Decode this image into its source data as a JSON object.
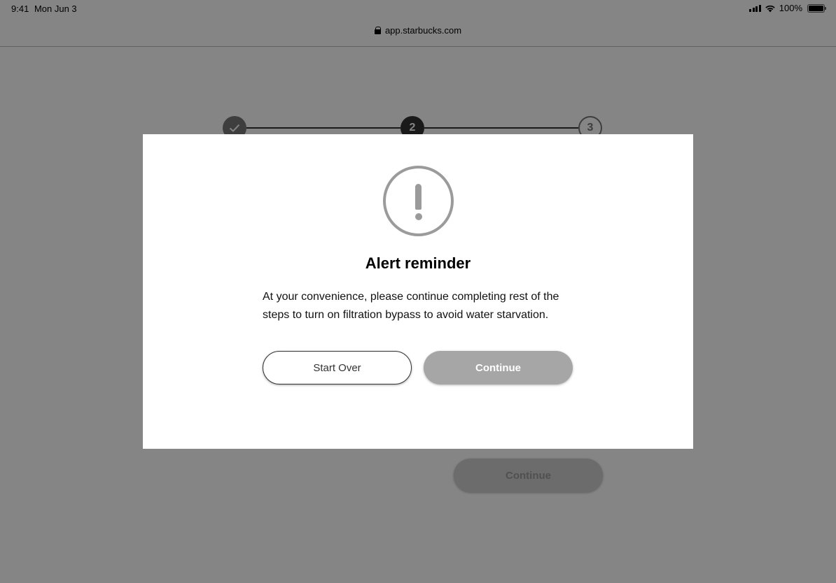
{
  "status_bar": {
    "time": "9:41",
    "date": "Mon Jun 3",
    "battery": "100%",
    "icons": [
      "cellular-signal-icon",
      "wifi-icon",
      "battery-icon"
    ]
  },
  "browser": {
    "url": "app.starbucks.com",
    "lock_icon": "lock-icon"
  },
  "stepper": {
    "steps": [
      {
        "label": "✓",
        "state": "complete"
      },
      {
        "label": "2",
        "state": "current"
      },
      {
        "label": "3",
        "state": "upcoming"
      }
    ]
  },
  "background_page": {
    "continue_label": "Continue"
  },
  "modal": {
    "icon": "exclamation-alert-icon",
    "title": "Alert reminder",
    "body": "At your convenience, please continue completing rest of the steps to turn on filtration bypass to avoid water starvation.",
    "start_over_label": "Start Over",
    "continue_label": "Continue"
  },
  "colors": {
    "overlay": "#7f7f7f",
    "modal_bg": "#ffffff",
    "primary_disabled": "#a6a6a6",
    "step_active": "#333333"
  }
}
